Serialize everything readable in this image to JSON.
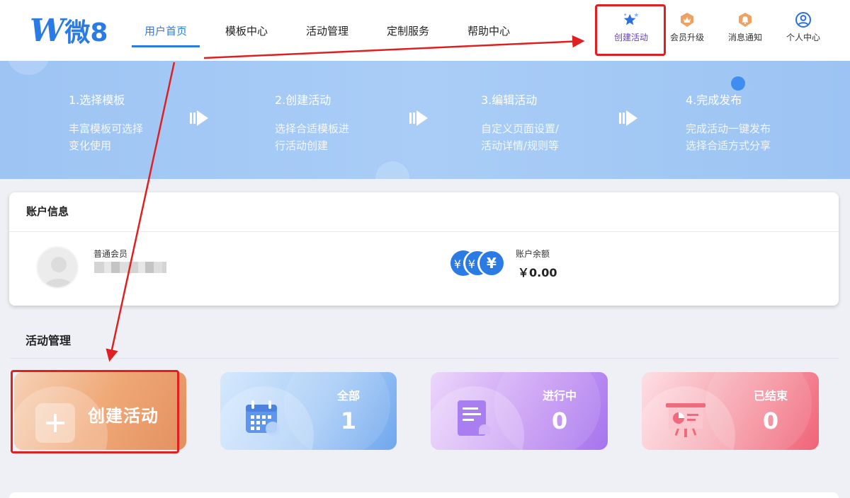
{
  "logo": {
    "letter": "W",
    "text": "微8"
  },
  "nav": {
    "items": [
      {
        "label": "用户首页",
        "active": true
      },
      {
        "label": "模板中心",
        "active": false
      },
      {
        "label": "活动管理",
        "active": false
      },
      {
        "label": "定制服务",
        "active": false
      },
      {
        "label": "帮助中心",
        "active": false
      }
    ]
  },
  "tools": {
    "create": {
      "label": "创建活动",
      "icon": "star-icon"
    },
    "upgrade": {
      "label": "会员升级",
      "icon": "crown-badge-icon"
    },
    "notify": {
      "label": "消息通知",
      "icon": "bell-badge-icon"
    },
    "profile": {
      "label": "个人中心",
      "icon": "user-circle-icon"
    }
  },
  "steps": [
    {
      "title": "1.选择模板",
      "line1": "丰富模板可选择",
      "line2": "变化使用"
    },
    {
      "title": "2.创建活动",
      "line1": "选择合适模板进",
      "line2": "行活动创建"
    },
    {
      "title": "3.编辑活动",
      "line1": "自定义页面设置/",
      "line2": "活动详情/规则等"
    },
    {
      "title": "4.完成发布",
      "line1": "完成活动一键发布",
      "line2": "选择合适方式分享"
    }
  ],
  "account": {
    "title": "账户信息",
    "member_label": "普通会员",
    "balance_label": "账户余额",
    "balance_value": "￥0.00",
    "coin_symbol": "¥"
  },
  "activity": {
    "title": "活动管理",
    "create_label": "创建活动",
    "tiles": [
      {
        "label": "全部",
        "count": "1"
      },
      {
        "label": "进行中",
        "count": "0"
      },
      {
        "label": "已结束",
        "count": "0"
      }
    ]
  },
  "colors": {
    "primary": "#2a7be4",
    "annotation_red": "#e02020"
  }
}
